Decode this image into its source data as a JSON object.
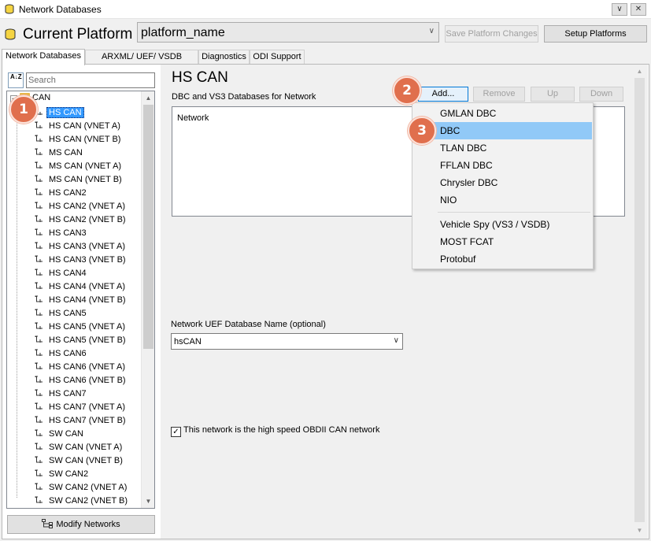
{
  "window": {
    "title": "Network Databases",
    "collapse_glyph": "∨",
    "close_glyph": "✕"
  },
  "header": {
    "title": "Current Platform",
    "platform_value": "platform_name",
    "save_label": "Save Platform Changes",
    "setup_label": "Setup Platforms"
  },
  "tabs": [
    {
      "label": "Network Databases"
    },
    {
      "label": "ARXML/ UEF/ VSDB Support"
    },
    {
      "label": "Diagnostics"
    },
    {
      "label": "ODI Support"
    }
  ],
  "left": {
    "sort_icon_text": "A↓Z",
    "search_placeholder": "Search",
    "root_label": "CAN",
    "root_toggle": "−",
    "items": [
      "HS CAN",
      "HS CAN (VNET A)",
      "HS CAN (VNET B)",
      "MS CAN",
      "MS CAN (VNET A)",
      "MS CAN (VNET B)",
      "HS CAN2",
      "HS CAN2 (VNET A)",
      "HS CAN2 (VNET B)",
      "HS CAN3",
      "HS CAN3 (VNET A)",
      "HS CAN3 (VNET B)",
      "HS CAN4",
      "HS CAN4 (VNET A)",
      "HS CAN4 (VNET B)",
      "HS CAN5",
      "HS CAN5 (VNET A)",
      "HS CAN5 (VNET B)",
      "HS CAN6",
      "HS CAN6 (VNET A)",
      "HS CAN6 (VNET B)",
      "HS CAN7",
      "HS CAN7 (VNET A)",
      "HS CAN7 (VNET B)",
      "SW CAN",
      "SW CAN (VNET A)",
      "SW CAN (VNET B)",
      "SW CAN2",
      "SW CAN2 (VNET A)",
      "SW CAN2 (VNET B)"
    ],
    "selected_index": 0,
    "modify_label": "Modify Networks"
  },
  "right": {
    "network_title": "HS CAN",
    "dbc_label": "DBC and VS3 Databases for Network",
    "buttons": {
      "add": "Add...",
      "remove": "Remove",
      "up": "Up",
      "down": "Down"
    },
    "list_column": "Network",
    "uef_label": "Network UEF Database Name (optional)",
    "uef_value": "hsCAN",
    "obd_label": "This network is the high speed OBDII CAN network",
    "obd_checked": true
  },
  "add_menu": {
    "items": [
      "GMLAN DBC",
      "DBC",
      "TLAN DBC",
      "FFLAN DBC",
      "Chrysler DBC",
      "NIO",
      "Vehicle Spy (VS3 / VSDB)",
      "MOST FCAT",
      "Protobuf"
    ],
    "hovered": "DBC"
  },
  "badges": [
    "1",
    "2",
    "3"
  ],
  "colors": {
    "badge": "#e06f4d",
    "selection": "#3399ff",
    "menu_hover": "#91c9f7"
  }
}
